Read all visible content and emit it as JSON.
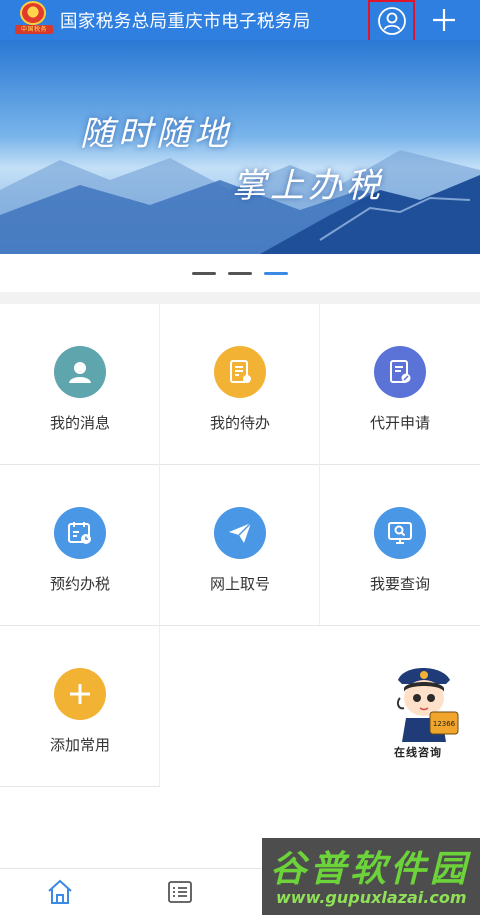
{
  "header": {
    "title": "国家税务总局重庆市电子税务局",
    "emblem_ribbon": "中国税务",
    "user_icon": "user-icon",
    "plus_icon": "plus-icon",
    "bg_color": "#2f7fe0",
    "highlight_color": "#e0152a"
  },
  "banner": {
    "line1": "随时随地",
    "line2": "掌上办税",
    "slides_total": 3,
    "active_slide": 3
  },
  "grid": {
    "items": [
      {
        "label": "我的消息",
        "icon": "user-avatar-icon",
        "color": "#5fa5ae"
      },
      {
        "label": "我的待办",
        "icon": "todo-document-icon",
        "color": "#f2b234"
      },
      {
        "label": "代开申请",
        "icon": "invoice-edit-icon",
        "color": "#5b73d6"
      },
      {
        "label": "预约办税",
        "icon": "calendar-clock-icon",
        "color": "#4a97e6"
      },
      {
        "label": "网上取号",
        "icon": "paper-plane-icon",
        "color": "#4a97e6"
      },
      {
        "label": "我要查询",
        "icon": "search-monitor-icon",
        "color": "#4a97e6"
      },
      {
        "label": "添加常用",
        "icon": "add-icon",
        "color": "#f2b234"
      }
    ]
  },
  "mascot": {
    "label": "在线咨询",
    "badge": "12366"
  },
  "bottom_nav": {
    "items": [
      {
        "icon": "home-icon",
        "active": true
      },
      {
        "icon": "list-icon",
        "active": false
      }
    ]
  },
  "watermark": {
    "title": "谷普软件园",
    "url": "www.gupuxlazai.com"
  }
}
